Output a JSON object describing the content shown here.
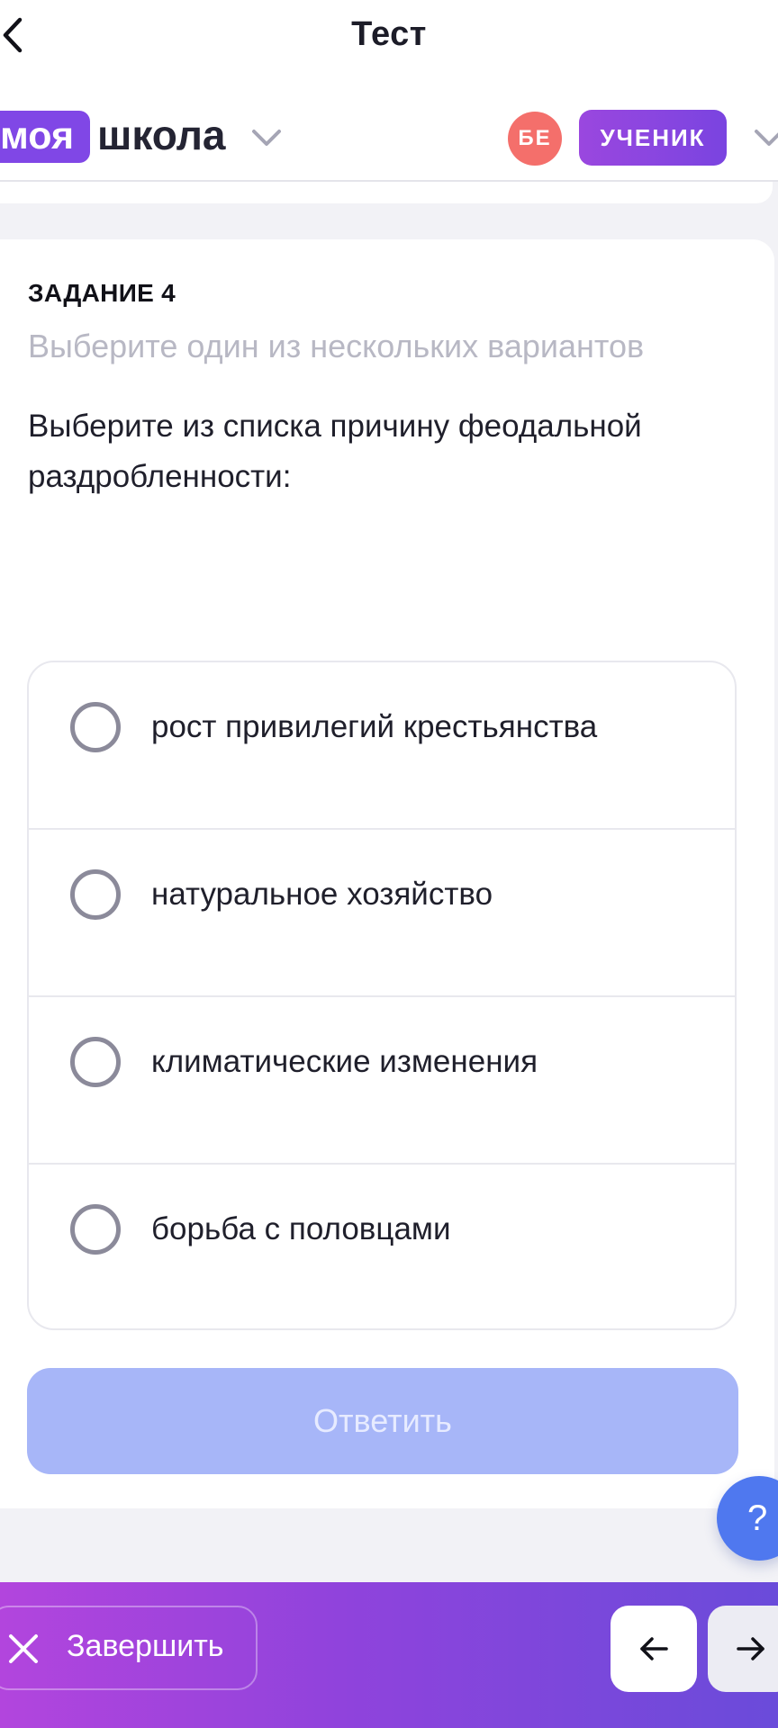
{
  "header": {
    "title": "Тест"
  },
  "school_bar": {
    "logo_highlight": "моя",
    "logo_word": "школа",
    "avatar_initials": "БЕ",
    "role_label": "УЧЕНИК"
  },
  "task": {
    "label": "ЗАДАНИЕ 4",
    "hint": "Выберите один из нескольких вариантов",
    "question": "Выберите из списка причину феодальной раздробленности:",
    "options": [
      {
        "label": "рост привилегий крестьянства",
        "selected": false
      },
      {
        "label": "натуральное хозяйство",
        "selected": false
      },
      {
        "label": "климатические изменения",
        "selected": false
      },
      {
        "label": "борьба с половцами",
        "selected": false
      }
    ],
    "answer_label": "Ответить"
  },
  "help": {
    "label": "?"
  },
  "footer": {
    "finish_label": "Завершить"
  },
  "colors": {
    "accent_purple": "#8047e6",
    "avatar_red": "#f46f6b",
    "answer_disabled": "#a7b6f8",
    "help_blue": "#4f78ef"
  }
}
